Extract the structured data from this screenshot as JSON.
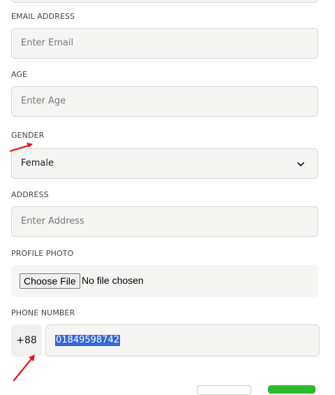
{
  "form": {
    "email": {
      "label": "EMAIL ADDRESS",
      "placeholder": "Enter Email"
    },
    "age": {
      "label": "AGE",
      "placeholder": "Enter Age"
    },
    "gender": {
      "label": "GENDER",
      "selected": "Female"
    },
    "address": {
      "label": "ADDRESS",
      "placeholder": "Enter Address"
    },
    "photo": {
      "label": "PROFILE PHOTO",
      "button_label": "Choose File",
      "status": "No file chosen"
    },
    "phone": {
      "label": "PHONE NUMBER",
      "prefix": "+88",
      "value": "01849598742"
    }
  },
  "colors": {
    "annotation_arrow": "#e3141b",
    "selection_highlight": "#3268d6",
    "submit_button": "#2eb82e"
  },
  "icons": {
    "gender_dropdown": "chevron-down-icon"
  }
}
